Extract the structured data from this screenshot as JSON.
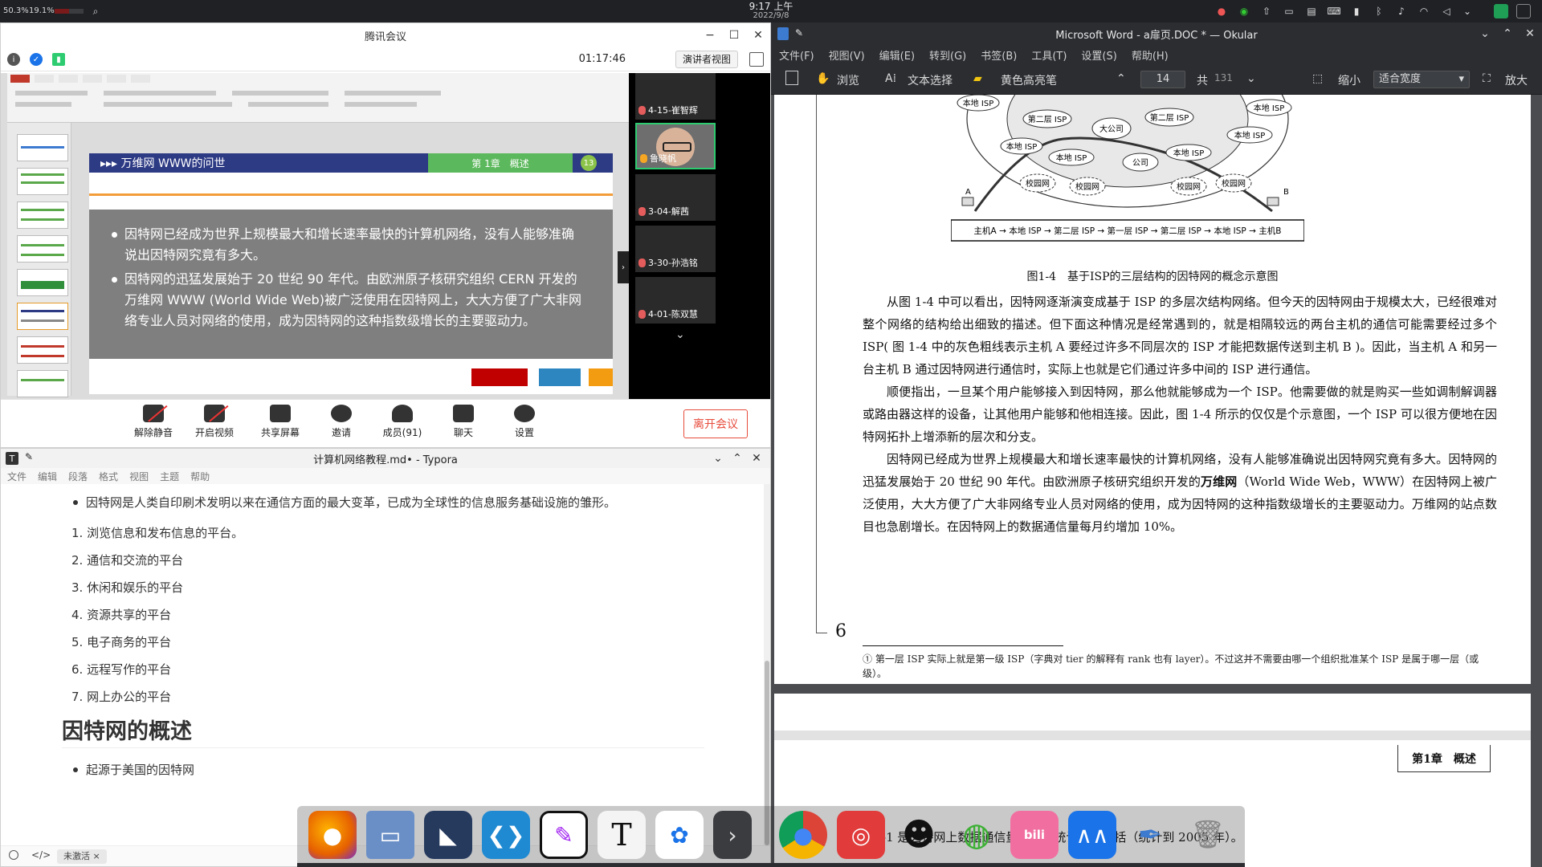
{
  "top_panel": {
    "cpu1": "50.3%",
    "cpu2": "19.1%",
    "cpu1_fraction": 0.5,
    "cpu2_fraction": 0.19,
    "clock_time": "9:17 上午",
    "clock_date": "2022/9/8",
    "tray_icons": [
      "meeting-tray-icon",
      "wechat-tray-icon",
      "upload-tray-icon",
      "screenshot-tray-icon",
      "clipboard-tray-icon",
      "keyboard-tray-icon",
      "battery-tray-icon",
      "bluetooth-tray-icon",
      "mic-muted-tray-icon",
      "wifi-tray-icon",
      "volume-tray-icon",
      "chevron-down-icon",
      "panel-green-icon",
      "panel-outline-icon"
    ]
  },
  "meeting": {
    "title": "腾讯会议",
    "timer": "01:17:46",
    "presenter_view": "演讲者视图",
    "slide": {
      "title": "▸▸▸ 万维网 WWW的问世",
      "chapter": "第 1章　概述",
      "page": "13",
      "bullets": [
        "因特网已经成为世界上规模最大和增长速率最快的计算机网络，没有人能够准确说出因特网究竟有多大。",
        "因特网的迅猛发展始于 20 世纪 90 年代。由欧洲原子核研究组织 CERN 开发的万维网 WWW (World Wide Web)被广泛使用在因特网上，大大方便了广大非网络专业人员对网络的使用，成为因特网的这种指数级增长的主要驱动力。"
      ]
    },
    "participants": [
      {
        "name": "4-15-崔智辉",
        "active": false
      },
      {
        "name": "鲁晓帆",
        "active": true
      },
      {
        "name": "3-04-解茜",
        "active": false
      },
      {
        "name": "3-30-孙浩铭",
        "active": false
      },
      {
        "name": "4-01-陈双慧",
        "active": false
      }
    ],
    "toolbar": {
      "unmute": "解除静音",
      "start_video": "开启视频",
      "share_screen": "共享屏幕",
      "invite": "邀请",
      "members": "成员(91)",
      "chat": "聊天",
      "settings": "设置",
      "leave": "离开会议"
    }
  },
  "typora": {
    "title": "计算机网络教程.md• - Typora",
    "menu": [
      "文件",
      "编辑",
      "段落",
      "格式",
      "视图",
      "主题",
      "帮助"
    ],
    "intro_bullet": "因特网是人类自印刷术发明以来在通信方面的最大变革，已成为全球性的信息服务基础设施的雏形。",
    "list_items": [
      "1. 浏览信息和发布信息的平台。",
      "2. 通信和交流的平台",
      "3. 休闲和娱乐的平台",
      "4. 资源共享的平台",
      "5. 电子商务的平台",
      "6. 远程写作的平台",
      "7. 网上办公的平台"
    ],
    "heading": "因特网的概述",
    "sub_bullet": "起源于美国的因特网",
    "status_badge": "未激活 ×"
  },
  "okular": {
    "title": "Microsoft Word - a扉页.DOC * — Okular",
    "menu": [
      "文件(F)",
      "视图(V)",
      "编辑(E)",
      "转到(G)",
      "书签(B)",
      "工具(T)",
      "设置(S)",
      "帮助(H)"
    ],
    "toolbar": {
      "browse": "浏览",
      "text_select": "文本选择",
      "highlighter": "黄色高亮笔",
      "page_current": "14",
      "page_of": "共",
      "page_total": "131",
      "zoom_out": "缩小",
      "zoom_mode": "适合宽度",
      "zoom_in": "放大"
    },
    "diagram": {
      "nodes": [
        "本地 ISP",
        "第二层 ISP",
        "大公司",
        "第二层 ISP",
        "本地 ISP",
        "本地 ISP",
        "本地 ISP",
        "本地 ISP",
        "公司",
        "本地 ISP",
        "校园网",
        "校园网",
        "校园网",
        "校园网"
      ],
      "host_a": "A",
      "host_b": "B",
      "path": "主机A → 本地 ISP → 第二层 ISP → 第一层 ISP → 第二层 ISP → 本地 ISP → 主机B"
    },
    "figure_caption": "图1-4　基于ISP的三层结构的因特网的概念示意图",
    "paragraphs": [
      "从图 1-4 中可以看出，因特网逐渐演变成基于 ISP 的多层次结构网络。但今天的因特网由于规模太大，已经很难对整个网络的结构给出细致的描述。但下面这种情况是经常遇到的，就是相隔较远的两台主机的通信可能需要经过多个 ISP( 图 1-4 中的灰色粗线表示主机 A 要经过许多不同层次的 ISP 才能把数据传送到主机 B )。因此，当主机 A 和另一台主机 B 通过因特网进行通信时，实际上也就是它们通过许多中间的 ISP 进行通信。",
      "顺便指出，一旦某个用户能够接入到因特网，那么他就能够成为一个 ISP。他需要做的就是购买一些如调制解调器或路由器这样的设备，让其他用户能够和他相连接。因此，图 1-4 所示的仅仅是个示意图，一个 ISP 可以很方便地在因特网拓扑上增添新的层次和分支。"
    ],
    "para3_before": "因特网已经成为世界上规模最大和增长速率最快的计算机网络，没有人能够准确说出因特网究竟有多大。因特网的迅猛发展始于 20 世纪 90 年代。由欧洲原子核研究组织开发的",
    "para3_bold": "万维网",
    "para3_after": "（World Wide Web，WWW）在因特网上被广泛使用，大大方便了广大非网络专业人员对网络的使用，成为因特网的这种指数级增长的主要驱动力。万维网的站点数目也急剧增长。在因特网上的数据通信量每月约增加 10%。",
    "footnote": "① 第一层 ISP 实际上就是第一级 ISP（字典对 tier 的解释有 rank 也有 layer）。不过这并不需要由哪一个组织批准某个 ISP 是属于哪一层（或级）。",
    "page_number": "6",
    "next_page_chapter": "第1章　概述",
    "next_page_text": "-1 是因特网上数据通信量的数据统计简单概括（统计到 2005 年）。"
  },
  "dock": {
    "apps": [
      "firefox-icon",
      "file-manager-icon",
      "cat-app-icon",
      "vscode-icon",
      "note-app-icon",
      "typora-icon",
      "baidu-netdisk-icon",
      "more-apps-icon",
      "chrome-icon",
      "netease-music-icon",
      "qq-icon",
      "wechat-icon",
      "bilibili-icon",
      "tencent-meeting-icon",
      "okular-icon",
      "trash-icon"
    ],
    "colors": {
      "firefox": "#e66000",
      "files": "#6a8fc7",
      "vscode": "#1f8ad2",
      "chrome": "#2d9b4a",
      "netease": "#e13b3b",
      "bilibili": "#f16fa0",
      "meeting": "#1a73e8"
    }
  }
}
